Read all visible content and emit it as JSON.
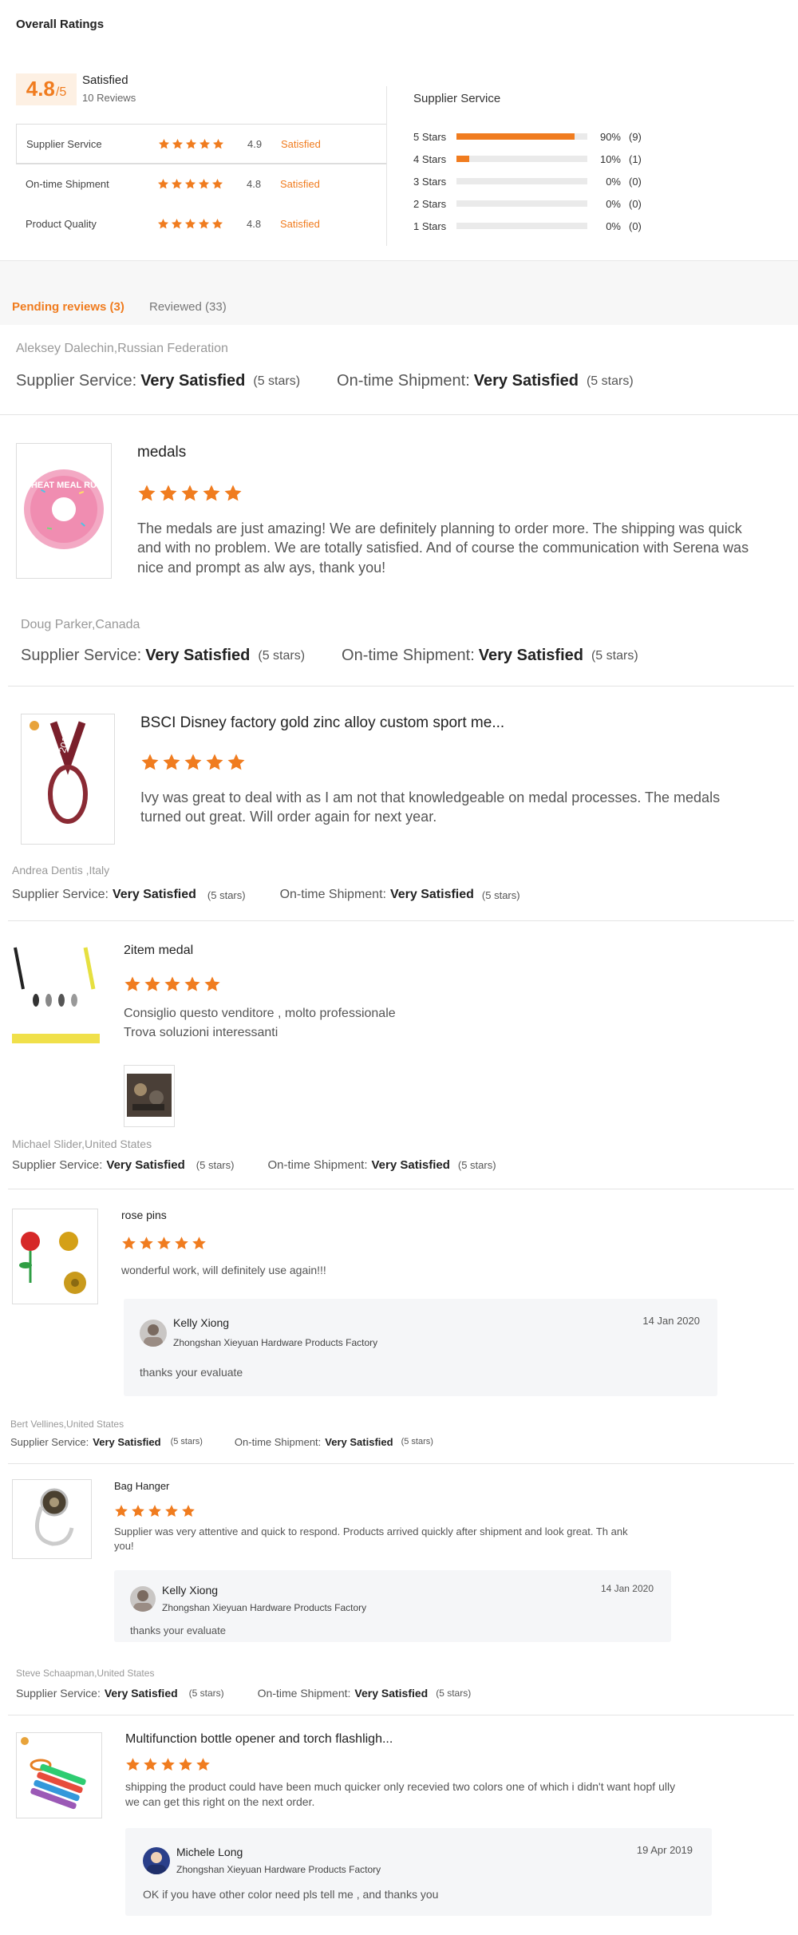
{
  "overall": {
    "title": "Overall Ratings",
    "score": "4.8",
    "score_denominator": "/5",
    "satisfaction": "Satisfied",
    "review_count": "10 Reviews"
  },
  "categories": [
    {
      "name": "Supplier Service",
      "stars": 5,
      "score": "4.9",
      "status": "Satisfied"
    },
    {
      "name": "On-time Shipment",
      "stars": 5,
      "score": "4.8",
      "status": "Satisfied"
    },
    {
      "name": "Product Quality",
      "stars": 5,
      "score": "4.8",
      "status": "Satisfied"
    }
  ],
  "distribution": {
    "title": "Supplier Service",
    "rows": [
      {
        "label": "5 Stars",
        "fraction": 0.9,
        "pct": "90%",
        "count": "(9)"
      },
      {
        "label": "4 Stars",
        "fraction": 0.1,
        "pct": "10%",
        "count": "(1)"
      },
      {
        "label": "3 Stars",
        "fraction": 0,
        "pct": "0%",
        "count": "(0)"
      },
      {
        "label": "2 Stars",
        "fraction": 0,
        "pct": "0%",
        "count": "(0)"
      },
      {
        "label": "1 Stars",
        "fraction": 0,
        "pct": "0%",
        "count": "(0)"
      }
    ]
  },
  "tabs": {
    "pending": "Pending reviews (3)",
    "reviewed": "Reviewed (33)"
  },
  "labels": {
    "supplier_service": "Supplier Service:",
    "ontime_shipment": "On-time Shipment:",
    "very_satisfied": "Very Satisfied",
    "five_stars": "(5 stars)"
  },
  "reviews": [
    {
      "reviewer": "Aleksey Dalechin,Russian Federation"
    },
    {
      "reviewer": "Doug Parker,Canada",
      "product": "medals",
      "stars": 5,
      "text": "The medals are just amazing! We are definitely planning to order more. The shipping was quick and with no problem. We are totally satisfied. And of course the communication with Serena was nice and prompt as alw ays, thank you!"
    },
    {
      "reviewer": "Andrea Dentis ,Italy",
      "product": "BSCI Disney factory gold zinc alloy custom sport me...",
      "stars": 5,
      "text": "Ivy was great to deal with as I am not that knowledgeable on medal processes.  The medals turned out great. Will order again for next year."
    },
    {
      "reviewer": "Michael Slider,United States",
      "product": "2item medal",
      "stars": 5,
      "text_lines": [
        "Consiglio questo venditore , molto professionale",
        "Trova soluzioni interessanti"
      ]
    },
    {
      "reviewer": "Bert Vellines,United States",
      "product": "rose pins",
      "stars": 5,
      "text": "wonderful work, will definitely use again!!!",
      "reply": {
        "name": "Kelly Xiong",
        "company": "Zhongshan Xieyuan Hardware Products Factory",
        "date": "14 Jan 2020",
        "message": "thanks  your  evaluate"
      }
    },
    {
      "reviewer": "Steve Schaapman,United States",
      "product": "Bag Hanger",
      "stars": 5,
      "text": "Supplier was very attentive and quick to respond. Products arrived quickly after shipment and look great. Th ank you!",
      "reply": {
        "name": "Kelly Xiong",
        "company": "Zhongshan Xieyuan Hardware Products Factory",
        "date": "14 Jan 2020",
        "message": "thanks  your  evaluate"
      }
    },
    {
      "product": "Multifunction bottle opener and torch flashligh...",
      "stars": 5,
      "text": "shipping the product could have been much quicker only recevied two colors one of which i didn't want hopf ully we can get this right on the next order.",
      "reply": {
        "name": "Michele Long",
        "company": "Zhongshan Xieyuan Hardware Products Factory",
        "date": "19 Apr 2019",
        "message": "OK  if  you have other  color need  pls tell me ,  and thanks you"
      }
    }
  ],
  "thumb_texts": {
    "donut": "CHEAT MEAL RUN",
    "ribbon": "2019"
  },
  "colors": {
    "accent": "#f07c1f",
    "star": "#f07c1f"
  }
}
